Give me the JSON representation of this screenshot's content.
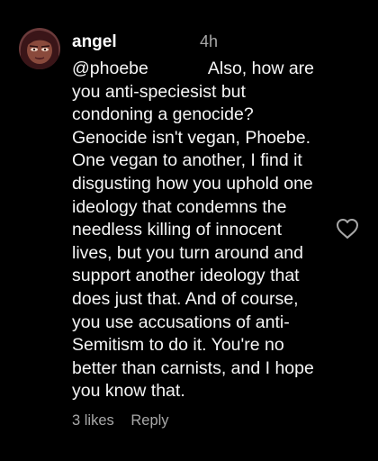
{
  "comment": {
    "username": "angel",
    "timestamp": "4h",
    "mention": "@phoebe",
    "lines": [
      "Also, how are",
      "you anti-speciesist but",
      "condoning a genocide?",
      "Genocide isn't vegan, Phoebe.",
      "One vegan to another, I find it",
      "disgusting how you uphold one",
      "ideology that condemns the",
      "needless killing of innocent",
      "lives, but you turn around and",
      "support another ideology that",
      "does just that. And of course,",
      "you use accusations of anti-",
      "Semitism to do it. You're no",
      "better than carnists, and I hope",
      "you know that."
    ],
    "likes_label": "3 likes",
    "reply_label": "Reply",
    "avatar_icon": "avatar-illustrated-face",
    "like_icon": "heart-outline-icon"
  },
  "colors": {
    "background": "#000000",
    "text": "#f5f5f5",
    "muted": "#a8a8a8"
  }
}
